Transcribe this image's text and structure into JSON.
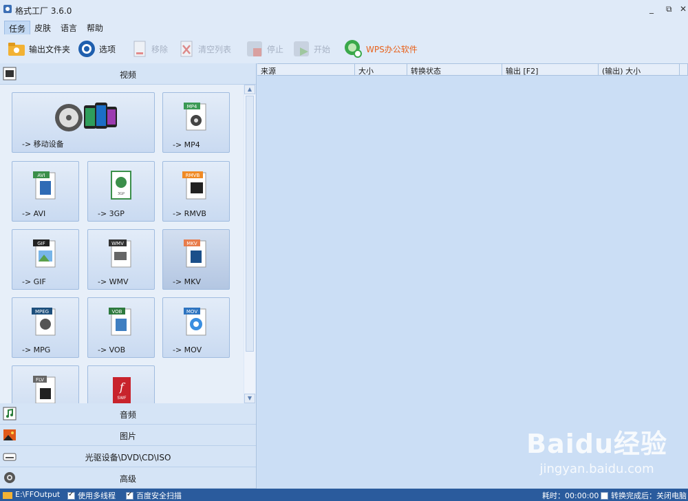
{
  "window": {
    "title": "格式工厂 3.6.0",
    "minimize": "_",
    "restore": "⧉",
    "close": "✕"
  },
  "menu": {
    "items": [
      "任务",
      "皮肤",
      "语言",
      "帮助"
    ]
  },
  "toolbar": {
    "output_folder": "输出文件夹",
    "options": "选项",
    "remove": "移除",
    "clear_list": "清空列表",
    "stop": "停止",
    "start": "开始",
    "wps": "WPS办公软件"
  },
  "sidebar": {
    "video_header": "视频",
    "tiles": [
      "-> 移动设备",
      "-> MP4",
      "-> AVI",
      "-> 3GP",
      "-> RMVB",
      "-> GIF",
      "-> WMV",
      "-> MKV",
      "-> MPG",
      "-> VOB",
      "-> MOV"
    ],
    "tile_badges": [
      "MP4",
      "AVI",
      "3GP",
      "RMVB",
      "GIF",
      "WMV",
      "MKV",
      "MPEG",
      "VOB",
      "MOV",
      "FLV",
      "SWF"
    ],
    "audio": "音频",
    "picture": "图片",
    "rom": "光驱设备\\DVD\\CD\\ISO",
    "advanced": "高级"
  },
  "table": {
    "columns": [
      "来源",
      "大小",
      "转换状态",
      "输出 [F2]",
      "(输出) 大小"
    ]
  },
  "watermark": {
    "main": "Baidu经验",
    "sub": "jingyan.baidu.com"
  },
  "status": {
    "path": "E:\\FFOutput",
    "multithread": "使用多线程",
    "scan": "百度安全扫描",
    "elapsed": "耗时：00:00:00",
    "after_done": "转换完成后：关闭电脑"
  },
  "colors": {
    "accent": "#2a5b9d",
    "wps": "#e8611a",
    "panel": "#cbdef5"
  }
}
